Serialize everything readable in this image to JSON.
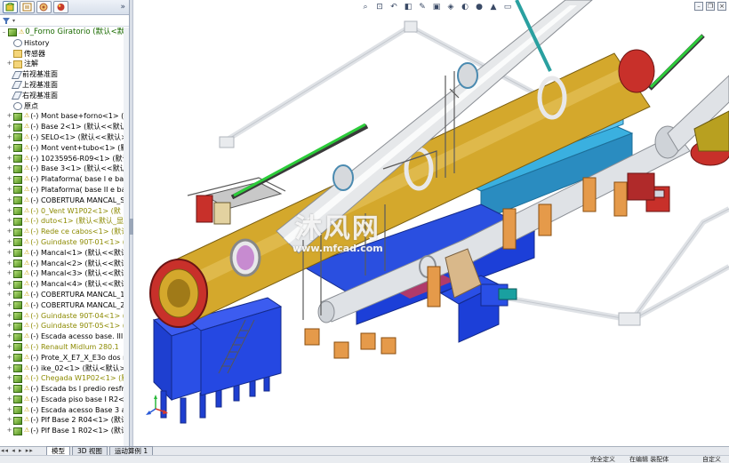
{
  "panel": {
    "tabs": [
      {
        "icon": "feature-manager-icon",
        "color": "#3d8a1e"
      },
      {
        "icon": "property-manager-icon",
        "color": "#b07a1a"
      },
      {
        "icon": "configuration-manager-icon",
        "color": "#b0572c"
      },
      {
        "icon": "appearance-icon",
        "color": "#c73a2a"
      }
    ],
    "more_label": "»",
    "filter_icon": "filter-icon"
  },
  "tree": {
    "root": {
      "label": "0_Forno Giratorio  (默认<默认"
    },
    "items": [
      {
        "label": "History",
        "icon": "history",
        "expand": "",
        "warn": false,
        "tone": ""
      },
      {
        "label": "传感器",
        "icon": "folder",
        "expand": "",
        "warn": false,
        "tone": ""
      },
      {
        "label": "注解",
        "icon": "folder",
        "expand": "+",
        "warn": false,
        "tone": ""
      },
      {
        "label": "前视基准面",
        "icon": "plane",
        "expand": "",
        "warn": false,
        "tone": ""
      },
      {
        "label": "上视基准面",
        "icon": "plane",
        "expand": "",
        "warn": false,
        "tone": ""
      },
      {
        "label": "右视基准面",
        "icon": "plane",
        "expand": "",
        "warn": false,
        "tone": ""
      },
      {
        "label": "原点",
        "icon": "origin",
        "expand": "",
        "warn": false,
        "tone": ""
      },
      {
        "label": "(-) Mont base+forno<1> (默",
        "icon": "asm",
        "expand": "+",
        "warn": true,
        "tone": ""
      },
      {
        "label": "(-) Base 2<1> (默认<<默认>_",
        "icon": "asm",
        "expand": "+",
        "warn": true,
        "tone": ""
      },
      {
        "label": "(-) SELO<1> (默认<<默认>_",
        "icon": "asm",
        "expand": "+",
        "warn": true,
        "tone": ""
      },
      {
        "label": "(-) Mont vent+tubo<1> (默认",
        "icon": "asm",
        "expand": "+",
        "warn": true,
        "tone": ""
      },
      {
        "label": "(-) 10235956-R09<1> (默认",
        "icon": "asm",
        "expand": "+",
        "warn": true,
        "tone": ""
      },
      {
        "label": "(-) Base 3<1> (默认<<默认>_",
        "icon": "asm",
        "expand": "+",
        "warn": true,
        "tone": ""
      },
      {
        "label": "(-) Plataforma( base I e bas",
        "icon": "asm",
        "expand": "+",
        "warn": true,
        "tone": ""
      },
      {
        "label": "(-) Plataforma( base II e ba",
        "icon": "asm",
        "expand": "+",
        "warn": true,
        "tone": ""
      },
      {
        "label": "(-) COBERTURA MANCAL_S",
        "icon": "asm",
        "expand": "+",
        "warn": true,
        "tone": ""
      },
      {
        "label": "(-) 0_Vent W1P02<1> (默",
        "icon": "asm",
        "expand": "+",
        "warn": true,
        "tone": "yellow"
      },
      {
        "label": "(-) duto<1> (默认<默认_显",
        "icon": "asm",
        "expand": "+",
        "warn": true,
        "tone": "yellow"
      },
      {
        "label": "(-) Rede ce cabos<1> (默认",
        "icon": "asm",
        "expand": "+",
        "warn": true,
        "tone": "yellow"
      },
      {
        "label": "(-) Guindaste 90T-01<1> (",
        "icon": "asm",
        "expand": "+",
        "warn": true,
        "tone": "yellow"
      },
      {
        "label": "(-) Mancal<1> (默认<<默认",
        "icon": "asm",
        "expand": "+",
        "warn": true,
        "tone": ""
      },
      {
        "label": "(-) Mancal<2> (默认<<默认",
        "icon": "asm",
        "expand": "+",
        "warn": true,
        "tone": ""
      },
      {
        "label": "(-) Mancal<3> (默认<<默认",
        "icon": "asm",
        "expand": "+",
        "warn": true,
        "tone": ""
      },
      {
        "label": "(-) Mancal<4> (默认<<默认",
        "icon": "asm",
        "expand": "+",
        "warn": true,
        "tone": ""
      },
      {
        "label": "(-) COBERTURA MANCAL_1",
        "icon": "asm",
        "expand": "+",
        "warn": true,
        "tone": ""
      },
      {
        "label": "(-) COBERTURA MANCAL_2",
        "icon": "asm",
        "expand": "+",
        "warn": true,
        "tone": ""
      },
      {
        "label": "(-) Guindaste 90T-04<1> (",
        "icon": "asm",
        "expand": "+",
        "warn": true,
        "tone": "yellow"
      },
      {
        "label": "(-) Guindaste 90T-05<1> (",
        "icon": "asm",
        "expand": "+",
        "warn": true,
        "tone": "yellow"
      },
      {
        "label": "(-) Escada acesso base. III<",
        "icon": "asm",
        "expand": "+",
        "warn": true,
        "tone": ""
      },
      {
        "label": "(-) Renault Midlum 280.1",
        "icon": "asm",
        "expand": "+",
        "warn": true,
        "tone": "yellow"
      },
      {
        "label": "(-) Prote_X_E7_X_E3o dos ro",
        "icon": "asm",
        "expand": "+",
        "warn": true,
        "tone": ""
      },
      {
        "label": "(-) ike_02<1> (默认<默认>_",
        "icon": "asm",
        "expand": "+",
        "warn": true,
        "tone": ""
      },
      {
        "label": "(-) Chegada W1P02<1> (默",
        "icon": "asm",
        "expand": "+",
        "warn": true,
        "tone": "yellow"
      },
      {
        "label": "(-) Escada bs I predio resfr",
        "icon": "asm",
        "expand": "+",
        "warn": true,
        "tone": ""
      },
      {
        "label": "(-) Escada piso base I R2<1",
        "icon": "asm",
        "expand": "+",
        "warn": true,
        "tone": ""
      },
      {
        "label": "(-) Escada acesso Base 3 a",
        "icon": "asm",
        "expand": "+",
        "warn": true,
        "tone": ""
      },
      {
        "label": "(-) Plf Base 2 R04<1> (默认",
        "icon": "asm",
        "expand": "+",
        "warn": true,
        "tone": ""
      },
      {
        "label": "(-) Plf Base 1 R02<1> (默认",
        "icon": "asm",
        "expand": "+",
        "warn": true,
        "tone": ""
      }
    ]
  },
  "viewport": {
    "toolbar_icons": [
      "zoom-to-fit-icon",
      "zoom-area-icon",
      "previous-view-icon",
      "section-view-icon",
      "dynamic-annotation-icon",
      "view-orientation-icon",
      "display-style-icon",
      "hide-show-icon",
      "edit-appearance-icon",
      "apply-scene-icon",
      "view-settings-icon"
    ],
    "window_controls": {
      "minimize": "–",
      "restore": "❐",
      "close": "×"
    },
    "watermark": {
      "title": "沐风网",
      "url": "www.mfcad.com"
    },
    "colors": {
      "kiln": "#d4a82c",
      "duct": "#e6e8ea",
      "structure_blue": "#1c3fd8",
      "platform_cyan": "#3ab0e0",
      "support_orange": "#e59a4a",
      "rail_red": "#c82a2a"
    }
  },
  "bottom_tabs": {
    "nav": "◂◂ ◂ ▸ ▸▸",
    "tabs": [
      {
        "label": "模型",
        "active": true
      },
      {
        "label": "3D 视图",
        "active": false
      },
      {
        "label": "运动算例 1",
        "active": false
      }
    ]
  },
  "status_bar": {
    "left": "",
    "center_a": "完全定义",
    "center_b": "在编辑 装配体",
    "right": "自定义"
  }
}
